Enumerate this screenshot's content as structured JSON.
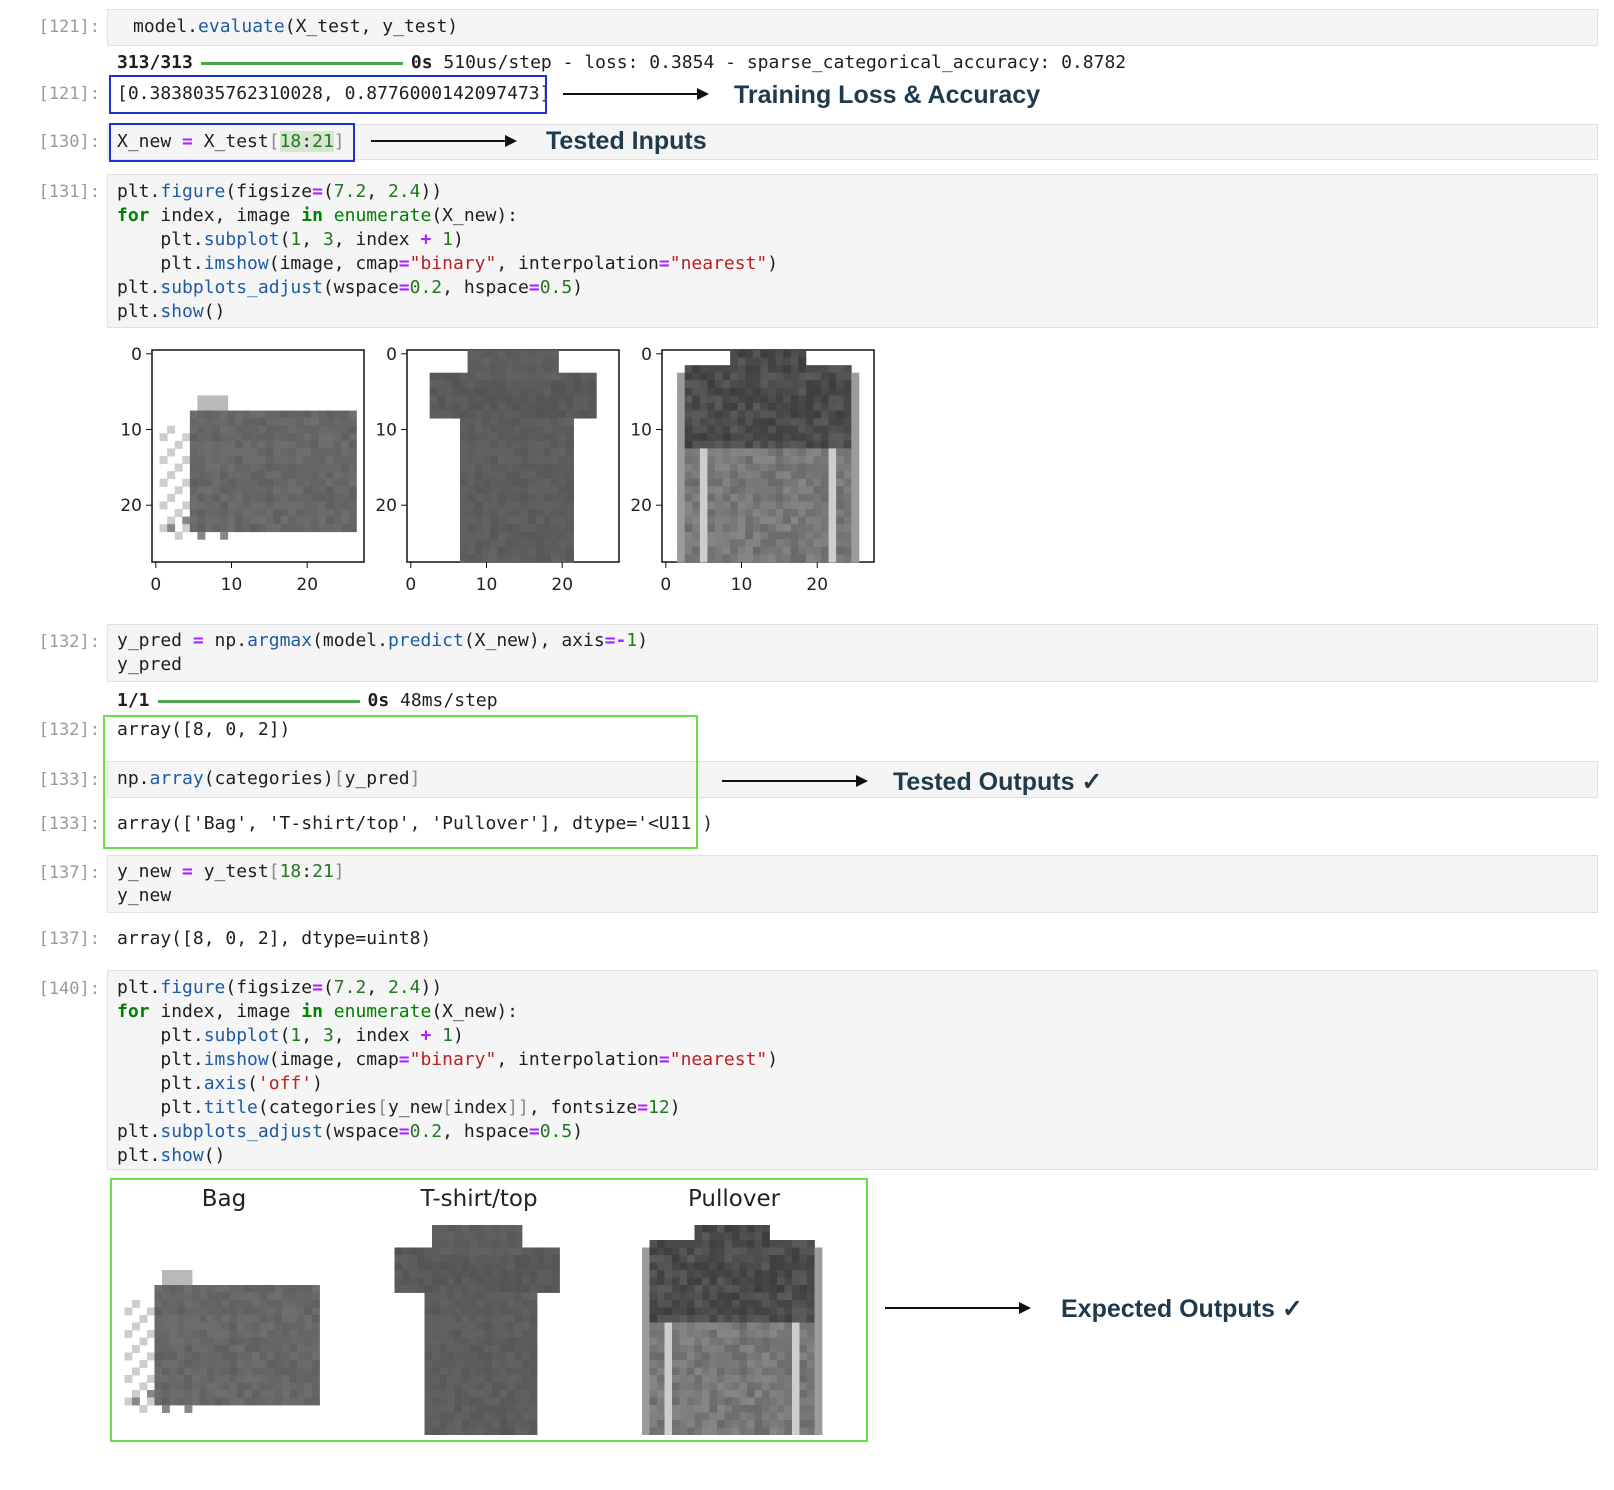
{
  "cells": {
    "c121_in": {
      "prompt": "[121]:"
    },
    "c121_progress": {
      "count": "313/313",
      "time": "0s",
      "rest": "510us/step - loss: 0.3854 - sparse_categorical_accuracy: 0.8782"
    },
    "c121_out": {
      "prompt": "[121]:",
      "text": "[0.3838035762310028, 0.8776000142097473]"
    },
    "c130": {
      "prompt": "[130]:"
    },
    "c131": {
      "prompt": "[131]:"
    },
    "c132_in": {
      "prompt": "[132]:"
    },
    "c132_progress": {
      "count": "1/1",
      "time": "0s",
      "rest": "48ms/step"
    },
    "c132_out": {
      "prompt": "[132]:",
      "text": "array([8, 0, 2])"
    },
    "c133_in": {
      "prompt": "[133]:"
    },
    "c133_out": {
      "prompt": "[133]:",
      "text": "array(['Bag', 'T-shirt/top', 'Pullover'], dtype='<U11')"
    },
    "c137_in": {
      "prompt": "[137]:"
    },
    "c137_out": {
      "prompt": "[137]:",
      "text": "array([8, 0, 2], dtype=uint8)"
    },
    "c140": {
      "prompt": "[140]:"
    }
  },
  "annotations": {
    "training": "Training Loss & Accuracy",
    "inputs": "Tested Inputs",
    "outputs": "Tested Outputs ✓",
    "expected": "Expected Outputs ✓"
  },
  "figure1": {
    "ticks": [
      "0",
      "10",
      "20"
    ],
    "images": [
      "bag",
      "tshirt",
      "pullover"
    ]
  },
  "figure2": {
    "titles": [
      "Bag",
      "T-shirt/top",
      "Pullover"
    ]
  }
}
